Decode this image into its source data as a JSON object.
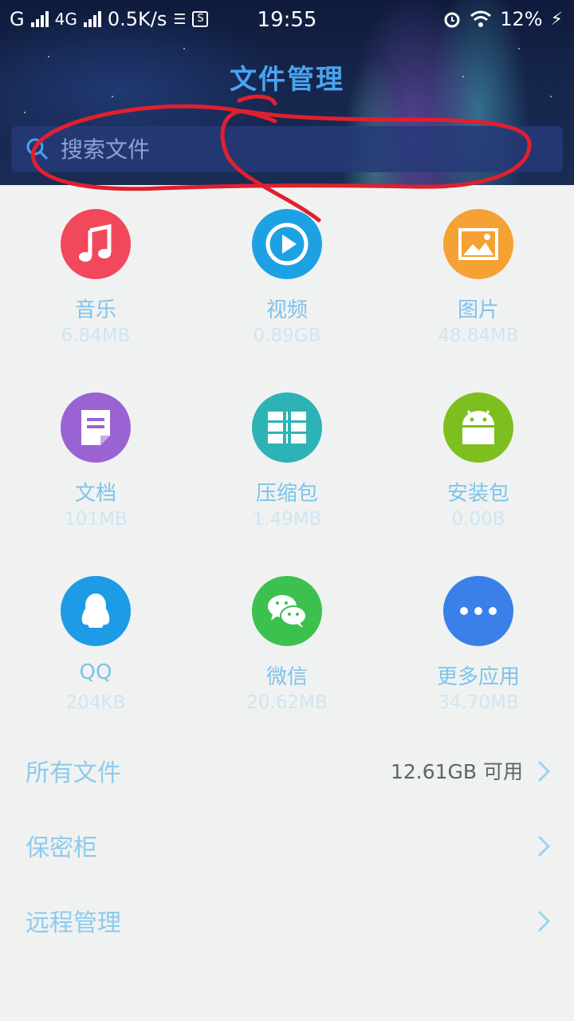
{
  "status_bar": {
    "carrier1": "G",
    "carrier2": "4G",
    "speed": "0.5K/s",
    "time": "19:55",
    "battery": "12%",
    "icons": [
      "signal-icon",
      "data-icon",
      "s-icon",
      "alarm-icon",
      "wifi-icon",
      "charging-icon"
    ]
  },
  "header": {
    "title": "文件管理",
    "search_placeholder": "搜索文件",
    "title_color": "#4aa3f0"
  },
  "categories": [
    {
      "name": "音乐",
      "size": "6.84MB",
      "icon": "music-icon",
      "color": "#f2485c"
    },
    {
      "name": "视频",
      "size": "0.89GB",
      "icon": "video-play-icon",
      "color": "#1ea1e4"
    },
    {
      "name": "图片",
      "size": "48.84MB",
      "icon": "image-icon",
      "color": "#f5a133"
    },
    {
      "name": "文档",
      "size": "101MB",
      "icon": "document-icon",
      "color": "#9a63d3"
    },
    {
      "name": "压缩包",
      "size": "1.49MB",
      "icon": "archive-icon",
      "color": "#2db3b6"
    },
    {
      "name": "安装包",
      "size": "0.00B",
      "icon": "android-icon",
      "color": "#7dbf1f"
    },
    {
      "name": "QQ",
      "size": "204KB",
      "icon": "qq-penguin-icon",
      "color": "#1d9be6"
    },
    {
      "name": "微信",
      "size": "20.62MB",
      "icon": "wechat-icon",
      "color": "#3cc14f"
    },
    {
      "name": "更多应用",
      "size": "34.70MB",
      "icon": "more-dots-icon",
      "color": "#3b7fe8"
    }
  ],
  "list": [
    {
      "label": "所有文件",
      "value": "12.61GB 可用"
    },
    {
      "label": "保密柜",
      "value": ""
    },
    {
      "label": "远程管理",
      "value": ""
    }
  ],
  "annotation": {
    "color": "#e0202e"
  }
}
